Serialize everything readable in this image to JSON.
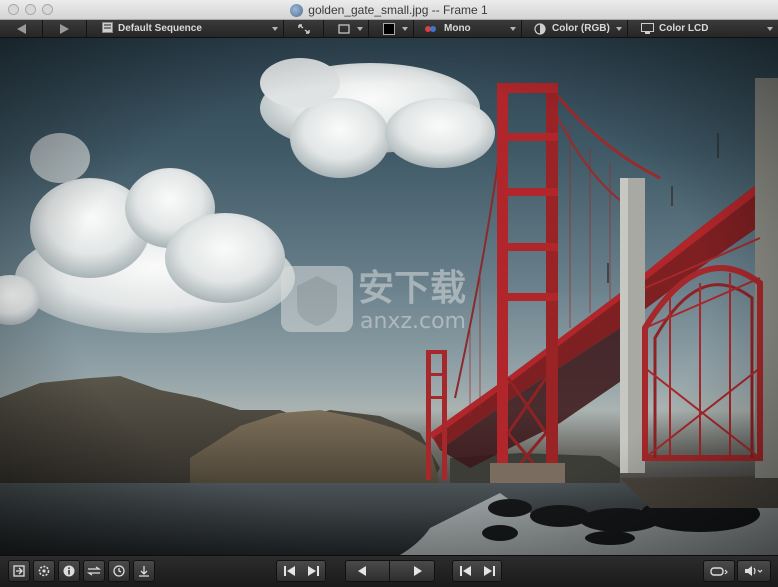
{
  "window": {
    "title": "golden_gate_small.jpg -- Frame 1"
  },
  "toolbar": {
    "sequence_label": "Default Sequence",
    "channel_label": "Mono",
    "color_space_label": "Color (RGB)",
    "display_label": "Color LCD"
  },
  "watermark": {
    "cn_text": "安下载",
    "domain_text": "anxz.com"
  },
  "colors": {
    "bridge_red": "#b0262a",
    "toolbar_bg": "#2b2b2b",
    "bottombar_bg": "#1f1f1f"
  },
  "icons": {
    "toolbar": [
      "back-arrow-icon",
      "forward-arrow-icon",
      "sequence-icon",
      "fit-icon",
      "frame-icon",
      "swatch-icon",
      "channels-icon",
      "color-space-icon",
      "display-icon"
    ],
    "bottom_left": [
      "export-icon",
      "settings-icon",
      "info-icon",
      "swap-icon",
      "timer-icon",
      "baseline-icon"
    ],
    "bottom_center": [
      "step-back-icon",
      "step-forward-icon",
      "play-reverse-icon",
      "play-forward-icon",
      "go-start-icon",
      "go-end-icon"
    ],
    "bottom_right": [
      "loop-icon",
      "volume-icon"
    ]
  }
}
